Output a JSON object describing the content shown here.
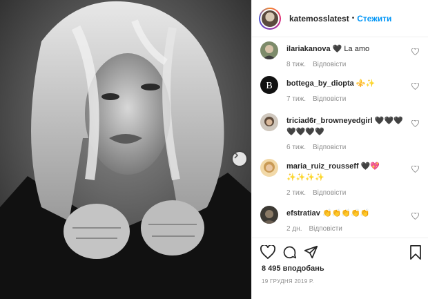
{
  "post": {
    "username": "katemosslatest",
    "separator": "•",
    "follow_label": "Стежити"
  },
  "comments": [
    {
      "user": "ilariakanova",
      "text": "🖤 La amo",
      "age": "8 тиж.",
      "reply": "Відповісти"
    },
    {
      "user": "bottega_by_diopta",
      "text": "⚜️✨",
      "age": "7 тиж.",
      "reply": "Відповісти"
    },
    {
      "user": "triciad6r_browneyedgirl",
      "text": "🖤🖤🖤🖤🖤🖤🖤",
      "age": "6 тиж.",
      "reply": "Відповісти"
    },
    {
      "user": "maria_ruiz_rousseff",
      "text": "🖤💖✨✨✨✨",
      "age": "2 тиж.",
      "reply": "Відповісти"
    },
    {
      "user": "efstratiav",
      "text": "👏👏👏👏👏",
      "age": "2 дн.",
      "reply": "Відповісти"
    }
  ],
  "footer": {
    "likes": "8 495 вподобань",
    "date": "19 ГРУДНЯ 2019 Р."
  },
  "icons": {
    "like": "heart-outline-icon",
    "comment": "speech-bubble-icon",
    "share": "paper-plane-icon",
    "save": "bookmark-icon",
    "next": "chevron-right-icon"
  }
}
